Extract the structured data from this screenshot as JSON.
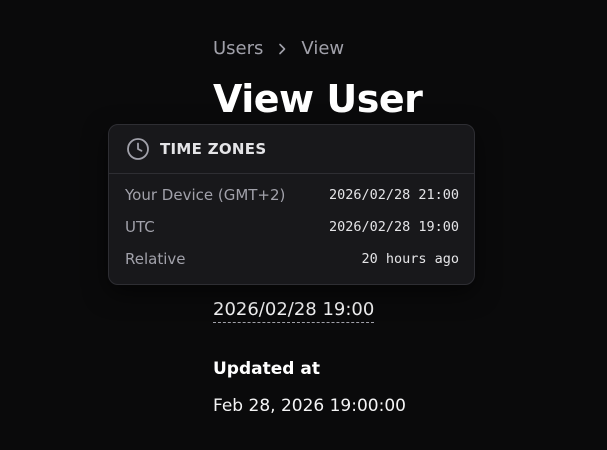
{
  "breadcrumb": {
    "parent": "Users",
    "current": "View"
  },
  "page": {
    "title": "View User"
  },
  "fields": {
    "created_value": "2026/02/28 19:00",
    "updated_label": "Updated at",
    "updated_value": "Feb 28, 2026 19:00:00"
  },
  "timezone_popover": {
    "icon": "clock-icon",
    "title": "TIME ZONES",
    "rows": [
      {
        "label": "Your Device (GMT+2)",
        "value": "2026/02/28 21:00"
      },
      {
        "label": "UTC",
        "value": "2026/02/28 19:00"
      },
      {
        "label": "Relative",
        "value": "20 hours ago"
      }
    ]
  },
  "colors": {
    "background": "#0a0a0b",
    "popover_bg": "#18181b",
    "muted_text": "#a1a1aa"
  }
}
